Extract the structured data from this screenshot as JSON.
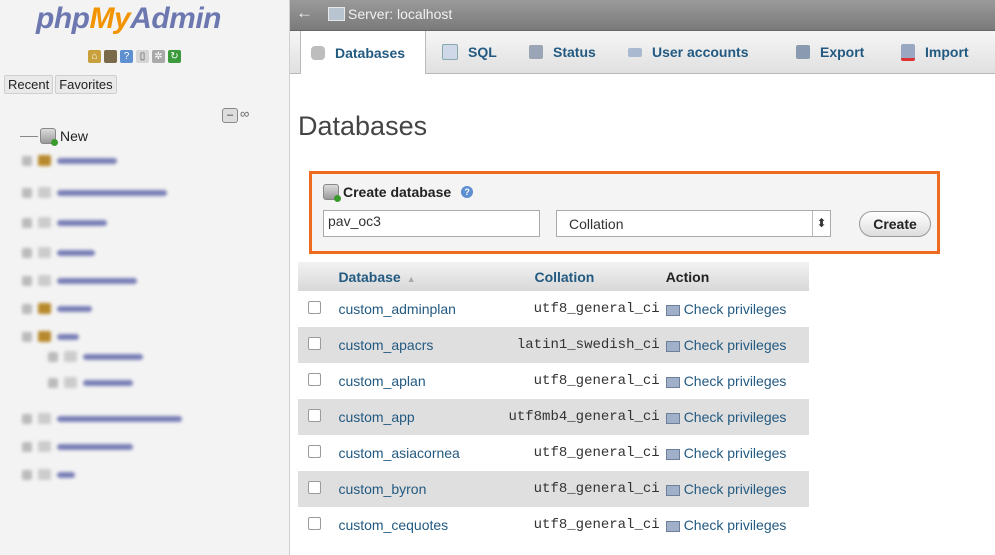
{
  "sidebar": {
    "logo": {
      "php": "php",
      "my": "My",
      "admin": "Admin"
    },
    "icons": [
      "home-icon",
      "exit-icon",
      "help-icon",
      "docs-icon",
      "settings-icon",
      "reload-icon"
    ],
    "tabs": {
      "recent": "Recent",
      "favorites": "Favorites"
    },
    "tree": {
      "new_label": "New"
    }
  },
  "topbar": {
    "server_label": "Server: localhost"
  },
  "tabs": [
    {
      "label": "Databases",
      "icon": "database-icon",
      "active": true
    },
    {
      "label": "SQL",
      "icon": "sql-icon"
    },
    {
      "label": "Status",
      "icon": "status-icon"
    },
    {
      "label": "User accounts",
      "icon": "users-icon"
    },
    {
      "label": "Export",
      "icon": "export-icon"
    },
    {
      "label": "Import",
      "icon": "import-icon"
    }
  ],
  "main": {
    "title": "Databases",
    "create": {
      "heading": "Create database",
      "name_value": "pav_oc3",
      "collation_value": "Collation",
      "button": "Create"
    },
    "table": {
      "headers": {
        "database": "Database",
        "collation": "Collation",
        "action": "Action"
      },
      "rows": [
        {
          "name": "custom_adminplan",
          "collation": "utf8_general_ci",
          "action": "Check privileges"
        },
        {
          "name": "custom_apacrs",
          "collation": "latin1_swedish_ci",
          "action": "Check privileges"
        },
        {
          "name": "custom_aplan",
          "collation": "utf8_general_ci",
          "action": "Check privileges"
        },
        {
          "name": "custom_app",
          "collation": "utf8mb4_general_ci",
          "action": "Check privileges"
        },
        {
          "name": "custom_asiacornea",
          "collation": "utf8_general_ci",
          "action": "Check privileges"
        },
        {
          "name": "custom_byron",
          "collation": "utf8_general_ci",
          "action": "Check privileges"
        },
        {
          "name": "custom_cequotes",
          "collation": "utf8_general_ci",
          "action": "Check privileges"
        }
      ]
    }
  },
  "colors": {
    "accent": "#ef6b1f",
    "link": "#235a81",
    "logo_blue": "#6c78af",
    "logo_orange": "#f29400"
  }
}
